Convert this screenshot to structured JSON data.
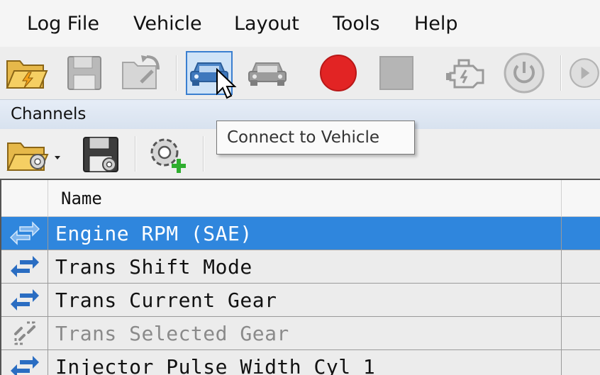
{
  "menu": {
    "items": [
      "Log File",
      "Vehicle",
      "Layout",
      "Tools",
      "Help"
    ]
  },
  "toolbar": {
    "buttons": [
      {
        "icon": "open-folder-icon"
      },
      {
        "icon": "save-icon"
      },
      {
        "icon": "export-icon"
      },
      {
        "icon": "connect-vehicle-icon",
        "active": true
      },
      {
        "icon": "disconnect-vehicle-icon"
      },
      {
        "icon": "record-icon"
      },
      {
        "icon": "stop-icon"
      },
      {
        "icon": "engine-icon"
      },
      {
        "icon": "power-icon"
      },
      {
        "icon": "play-icon"
      }
    ]
  },
  "channels_panel": {
    "title": "Channels",
    "toolbar": [
      {
        "icon": "open-config-icon"
      },
      {
        "icon": "save-config-icon"
      },
      {
        "icon": "add-channel-icon"
      }
    ]
  },
  "tooltip": {
    "text": "Connect to Vehicle"
  },
  "grid": {
    "columns": [
      "Name"
    ],
    "rows": [
      {
        "name": "Engine RPM (SAE)",
        "icon": "linked-arrows-icon",
        "selected": true
      },
      {
        "name": "Trans Shift Mode",
        "icon": "linked-arrows-icon"
      },
      {
        "name": "Trans Current Gear",
        "icon": "linked-arrows-icon"
      },
      {
        "name": "Trans Selected Gear",
        "icon": "broken-link-icon",
        "disabled": true
      },
      {
        "name": "Injector Pulse Width Cyl 1",
        "icon": "linked-arrows-icon"
      }
    ]
  },
  "colors": {
    "selection": "#2f86dd",
    "record": "#e22424",
    "active_border": "#3a7fd0"
  }
}
